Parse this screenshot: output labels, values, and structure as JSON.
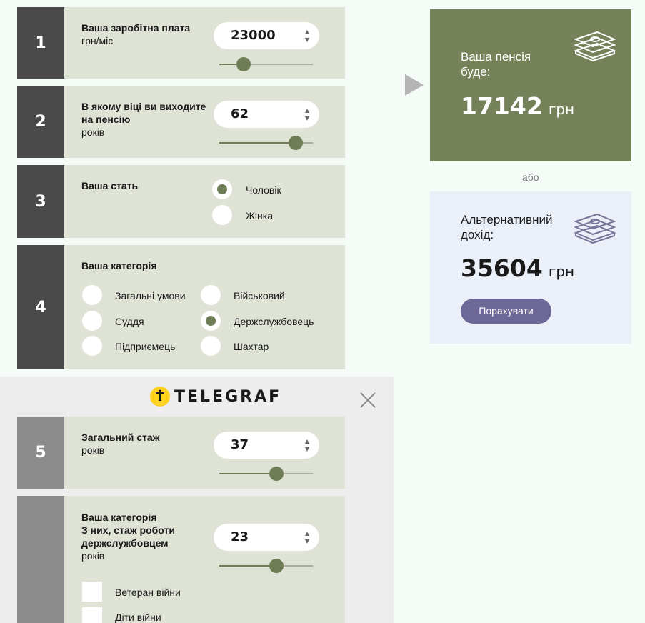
{
  "steps": {
    "s1": {
      "num": "1",
      "title": "Ваша заробітна плата",
      "unit": "грн/міс",
      "value": "23000",
      "slider_pct": 0.26
    },
    "s2": {
      "num": "2",
      "title": "В якому віці ви виходите на пенсію",
      "unit": "років",
      "value": "62",
      "slider_pct": 0.82
    },
    "s3": {
      "num": "3",
      "title": "Ваша стать",
      "options": [
        "Чоловік",
        "Жінка"
      ],
      "selected": "Чоловік"
    },
    "s4": {
      "num": "4",
      "title": "Ваша категорія",
      "options": [
        "Загальні умови",
        "Військовий",
        "Суддя",
        "Держслужбовець",
        "Підприємець",
        "Шахтар"
      ],
      "selected": "Держслужбовець"
    },
    "s5": {
      "num": "5",
      "title": "Загальний стаж",
      "unit": "років",
      "value": "37",
      "slider_pct": 0.61
    },
    "s6": {
      "title1": "Ваша категорія",
      "title2": "З них, стаж роботи держслужбовцем",
      "unit": "років",
      "value": "23",
      "slider_pct": 0.61,
      "checks": [
        "Ветеран війни",
        "Діти війни"
      ]
    }
  },
  "spinner_arrows": {
    "up": "▲",
    "down": "▼"
  },
  "pension": {
    "caption": "Ваша пенсія буде:",
    "amount": "17142",
    "unit": "грн",
    "icon": "money-stack-icon"
  },
  "or_text": "або",
  "alt": {
    "caption": "Альтернативний дохід:",
    "amount": "35604",
    "unit": "грн",
    "button": "Порахувати",
    "icon": "money-stack-icon"
  },
  "overlay": {
    "brand": "TELEGRAF",
    "close_icon": "close-icon"
  },
  "colors": {
    "accent": "#748159",
    "alt_bg": "#eaeff8",
    "button": "#6d6897",
    "panel": "#dee3d6",
    "num_dark": "#4a4a4a",
    "logo_yellow": "#ffd21f"
  }
}
